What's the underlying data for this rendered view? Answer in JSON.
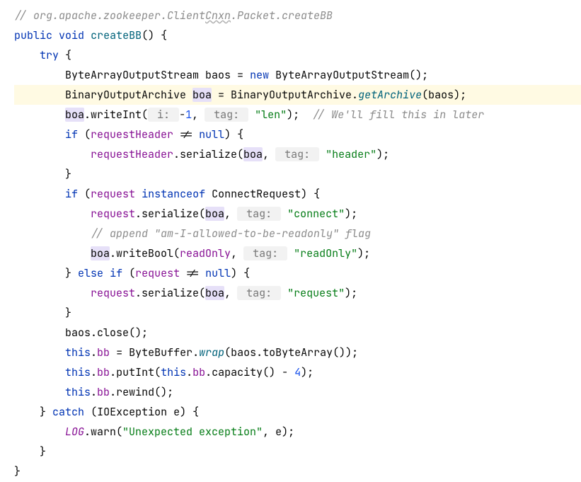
{
  "line01_a": "// org.apache.zookeeper.Client",
  "line01_b": "Cnxn",
  "line01_c": ".Packet.createBB",
  "kw_public": "public",
  "kw_void": "void",
  "name_createBB": "createBB",
  "sig_paren": "() {",
  "kw_try": "try",
  "brace_open": " {",
  "type_BAOS": "ByteArrayOutputStream ",
  "var_baos": "baos",
  "eq": " = ",
  "kw_new": "new",
  "ctor_BAOS": " ByteArrayOutputStream();",
  "type_BOA": "BinaryOutputArchive ",
  "var_boa": "boa",
  "eq2": " = BinaryOutputArchive.",
  "m_getArchive": "getArchive",
  "args_getArchive": "(baos);",
  "boa_dot": ".writeInt(",
  "hint_i": " i: ",
  "lit_neg1": "-1",
  "comma_sp": ", ",
  "hint_tag": " tag: ",
  "s_len": "\"len\"",
  "close_paren_semi": ");",
  "c_fill": "// We'll fill this in later",
  "kw_if": "if",
  "sp_openp": " (",
  "f_requestHeader": "requestHeader",
  "neq": " != ",
  "kw_null": "null",
  "closep_brace": ") {",
  "m_serialize": ".serialize(",
  "s_header": "\"header\"",
  "brace_close": "}",
  "f_request": "request",
  "kw_instanceof": "instanceof",
  "type_ConnectRequest": " ConnectRequest) {",
  "s_connect": "\"connect\"",
  "c_append": "// append \"am-I-allowed-to-be-readonly\" flag",
  "m_writeBool": ".writeBool(",
  "f_readOnly": "readOnly",
  "s_readOnly": "\"readOnly\"",
  "kw_else": "else",
  "s_request": "\"request\"",
  "baos_close": "baos.close();",
  "kw_this": "this",
  "dot": ".",
  "f_bb": "bb",
  "assign_wrap_a": " = ByteBuffer.",
  "m_wrap": "wrap",
  "assign_wrap_b": "(baos.toByteArray());",
  "m_putInt_a": ".putInt(",
  "m_capacity": ".capacity() - ",
  "lit_4": "4",
  "m_rewind": ".rewind();",
  "kw_catch": "catch",
  "catch_sig": " (IOException e) {",
  "f_LOG": "LOG",
  "m_warn": ".warn(",
  "s_unexpected": "\"Unexpected exception\"",
  "warn_tail": ", e);"
}
